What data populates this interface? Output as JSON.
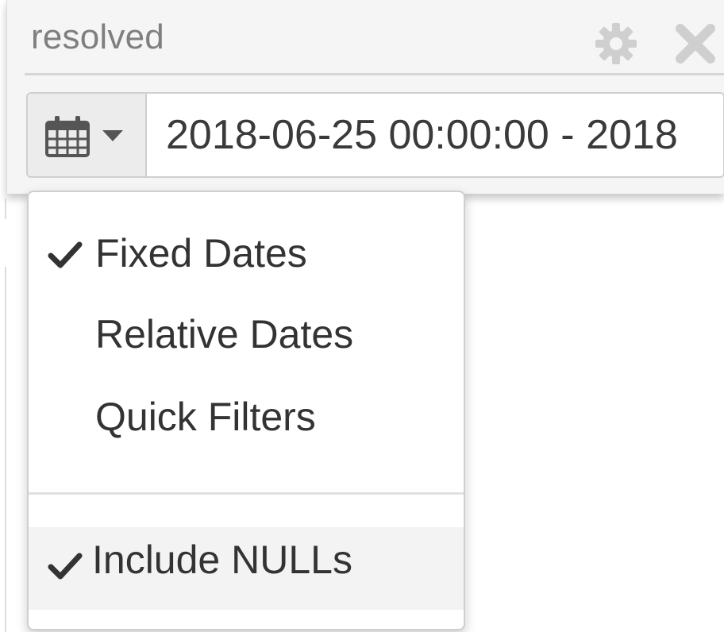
{
  "panel": {
    "title": "resolved",
    "icons": {
      "settings": "gear-icon",
      "close": "close-icon"
    }
  },
  "date_range": {
    "addon_icon": "calendar-icon",
    "addon_caret": "caret-down-icon",
    "value": "2018-06-25 00:00:00 - 2018"
  },
  "menu": {
    "items": [
      {
        "label": "Fixed Dates",
        "checked": true
      },
      {
        "label": "Relative Dates",
        "checked": false
      },
      {
        "label": "Quick Filters",
        "checked": false
      }
    ],
    "include_nulls": {
      "label": "Include NULLs",
      "checked": true
    }
  },
  "colors": {
    "panel_bg": "#f5f5f5",
    "text": "#333333",
    "muted": "#7f7f7f",
    "icon": "#cfcfcf"
  }
}
